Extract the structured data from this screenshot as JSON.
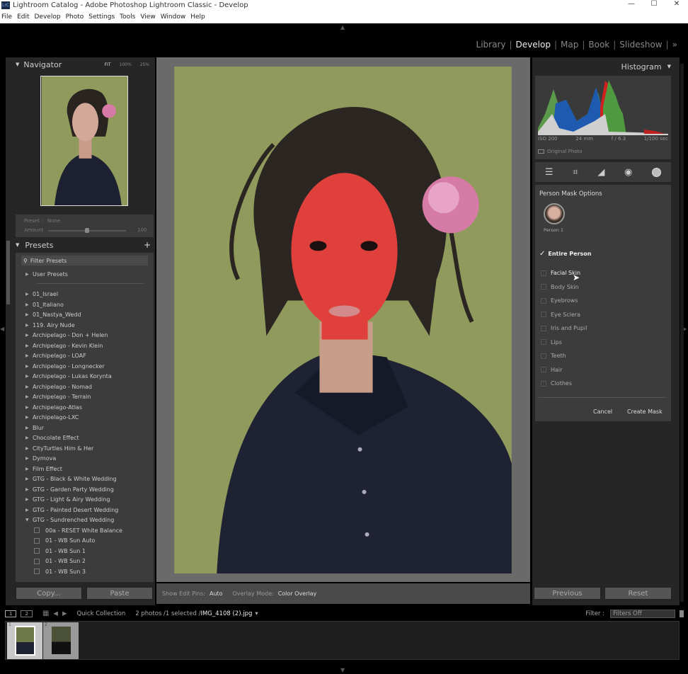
{
  "window": {
    "title": "Lightroom Catalog - Adobe Photoshop Lightroom Classic - Develop",
    "logo": "LrC",
    "minimize": "—",
    "maximize": "☐",
    "close": "✕"
  },
  "menu": [
    "File",
    "Edit",
    "Develop",
    "Photo",
    "Settings",
    "Tools",
    "View",
    "Window",
    "Help"
  ],
  "modules": [
    "Library",
    "Develop",
    "Map",
    "Book",
    "Slideshow"
  ],
  "modules_more": "»",
  "navigator": {
    "title": "Navigator",
    "zoom": [
      "FIT",
      "100%",
      "25%"
    ]
  },
  "preset_amount": {
    "preset_label": "Preset :",
    "preset_value": "None",
    "amount_label": "Amount",
    "amount_value": "100",
    "amount_fraction": 0.5
  },
  "presets": {
    "title": "Presets",
    "add": "+",
    "filter_placeholder": "Filter Presets",
    "user_presets": "User Presets",
    "groups": [
      "01_Israel",
      "01_Italiano",
      "01_Nastya_Wedd",
      "119. Airy Nude",
      "Archipelago - Don + Helen",
      "Archipelago - Kevin Klein",
      "Archipelago - LOAF",
      "Archipelago - Longnecker",
      "Archipelago - Lukas Korynta",
      "Archipelago - Nomad",
      "Archipelago - Terrain",
      "Archipelago-Atlas",
      "Archipelago-LXC",
      "Blur",
      "Chocolate Effect",
      "CityTurtles Him & Her",
      "Dymova",
      "Film Effect",
      "GTG - Black & White Wedding",
      "GTG - Garden Party Wedding",
      "GTG - Light & Airy Wedding",
      "GTG - Painted Desert Wedding"
    ],
    "expanded_group": "GTG - Sundrenched Wedding",
    "expanded_items": [
      "00a - RESET White Balance",
      "01 - WB Sun  Auto",
      "01 - WB Sun 1",
      "01 - WB Sun 2",
      "01 - WB Sun 3"
    ]
  },
  "left_buttons": {
    "copy": "Copy...",
    "paste": "Paste"
  },
  "toolbar": {
    "edit_pins_label": "Show Edit Pins:",
    "edit_pins_value": "Auto",
    "overlay_label": "Overlay Mode:",
    "overlay_value": "Color Overlay"
  },
  "histogram": {
    "title": "Histogram",
    "iso": "ISO 200",
    "focal": "24 mm",
    "aperture": "f / 6.3",
    "shutter": "1/100 sec",
    "original_photo": "Original Photo"
  },
  "tools": [
    "sliders-icon",
    "crop-icon",
    "healing-icon",
    "redeye-icon",
    "masking-icon"
  ],
  "mask": {
    "title": "Person Mask Options",
    "person": "Person 1",
    "entire": "Entire Person",
    "entire_checked": true,
    "options": [
      "Facial Skin",
      "Body Skin",
      "Eyebrows",
      "Eye Sclera",
      "Iris and Pupil",
      "Lips",
      "Teeth",
      "Hair",
      "Clothes"
    ],
    "cancel": "Cancel",
    "create": "Create Mask"
  },
  "right_buttons": {
    "previous": "Previous",
    "reset": "Reset"
  },
  "filmstrip": {
    "view1": "1",
    "view2": "2",
    "source": "Quick Collection",
    "info": "2 photos /1 selected /",
    "filename": "IMG_4108 (2).jpg",
    "filter_label": "Filter :",
    "filter_value": "Filters Off",
    "thumbs": [
      "1",
      "2"
    ]
  },
  "colors": {
    "mask_overlay": "#e0403c",
    "background_green": "#8f9a5c",
    "panel": "#3c3c3c"
  }
}
